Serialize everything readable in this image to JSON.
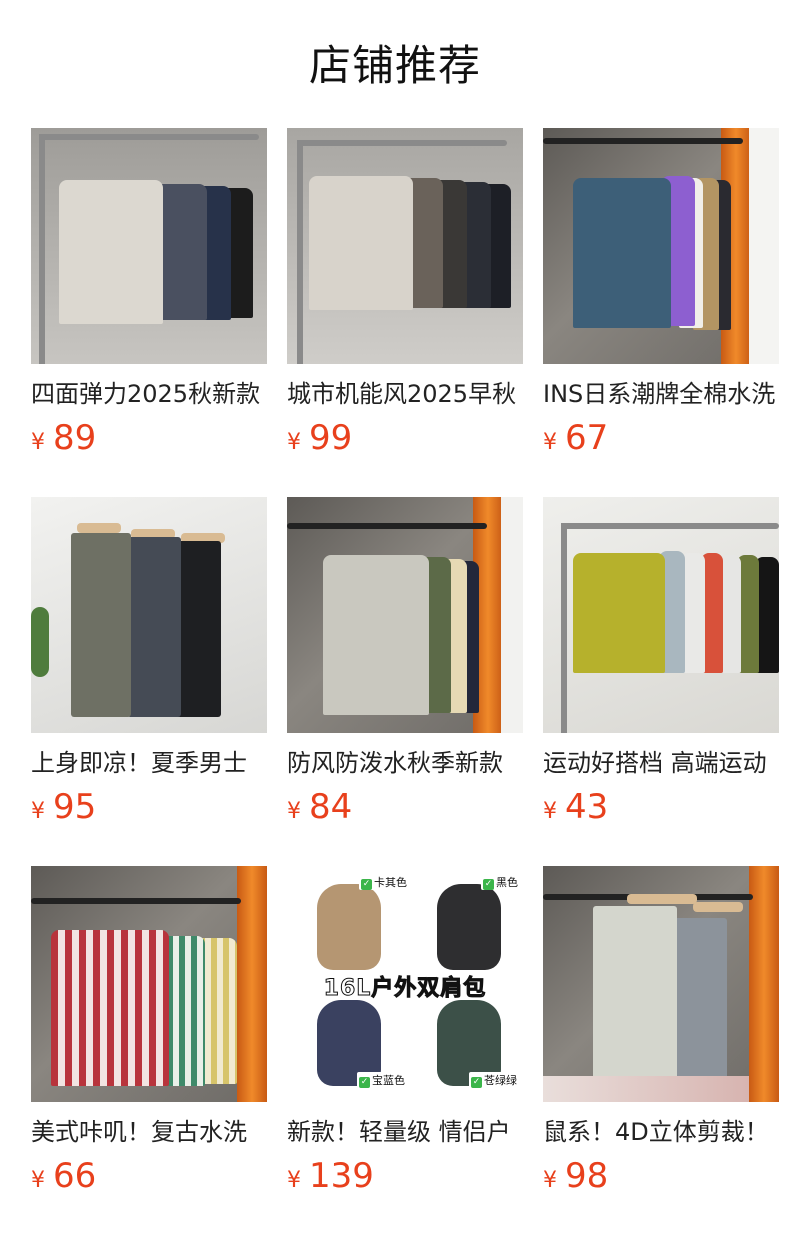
{
  "page": {
    "title": "店铺推荐"
  },
  "currency": "¥",
  "products": [
    {
      "name": "四面弹力2025秋新款",
      "price": "89"
    },
    {
      "name": "城市机能风2025早秋",
      "price": "99"
    },
    {
      "name": "INS日系潮牌全棉水洗",
      "price": "67"
    },
    {
      "name": "上身即凉！夏季男士",
      "price": "95"
    },
    {
      "name": "防风防泼水秋季新款",
      "price": "84"
    },
    {
      "name": "运动好搭档 高端运动",
      "price": "43"
    },
    {
      "name": "美式咔叽！复古水洗",
      "price": "66"
    },
    {
      "name": "新款！轻量级 情侣户",
      "price": "139"
    },
    {
      "name": "鼠系！4D立体剪裁！",
      "price": "98"
    }
  ],
  "bag_image": {
    "headline": "16L户外双肩包",
    "colors": [
      "卡其色",
      "黑色",
      "宝蓝色",
      "苍绿绿"
    ]
  },
  "colors": {
    "price": "#e8401c",
    "title": "#111111"
  }
}
